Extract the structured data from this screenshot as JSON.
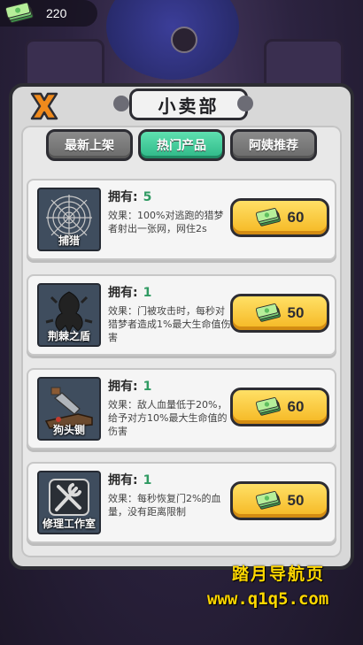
{
  "currency": {
    "amount": "220",
    "icon": "cash-stack-icon"
  },
  "shop": {
    "title": "小卖部",
    "close_icon": "close-x-icon",
    "tabs": [
      {
        "label": "最新上架",
        "active": false
      },
      {
        "label": "热门产品",
        "active": true
      },
      {
        "label": "阿姨推荐",
        "active": false
      }
    ],
    "items": [
      {
        "name": "捕猎",
        "owned_label": "拥有:",
        "owned": "5",
        "effect": "效果：100%对逃跑的猎梦者射出一张网，网住2s",
        "price": "60",
        "icon": "spider-web-icon"
      },
      {
        "name": "荆棘之盾",
        "owned_label": "拥有:",
        "owned": "1",
        "effect": "效果：门被攻击时，每秒对猎梦者造成1%最大生命值伤害",
        "price": "50",
        "icon": "thorn-shield-icon"
      },
      {
        "name": "狗头铡",
        "owned_label": "拥有:",
        "owned": "1",
        "effect": "效果：敌人血量低于20%，给予对方10%最大生命值的伤害",
        "price": "60",
        "icon": "guillotine-icon"
      },
      {
        "name": "修理工作室",
        "owned_label": "拥有:",
        "owned": "1",
        "effect": "效果：每秒恢复门2%的血量，没有距离限制",
        "price": "50",
        "icon": "repair-tools-icon"
      }
    ]
  },
  "watermark": {
    "line1": "踏月导航页",
    "line2": "www.q1q5.com"
  },
  "colors": {
    "accent_green": "#2eb887",
    "button_yellow": "#f5b722",
    "owned_green": "#2f9a62"
  }
}
